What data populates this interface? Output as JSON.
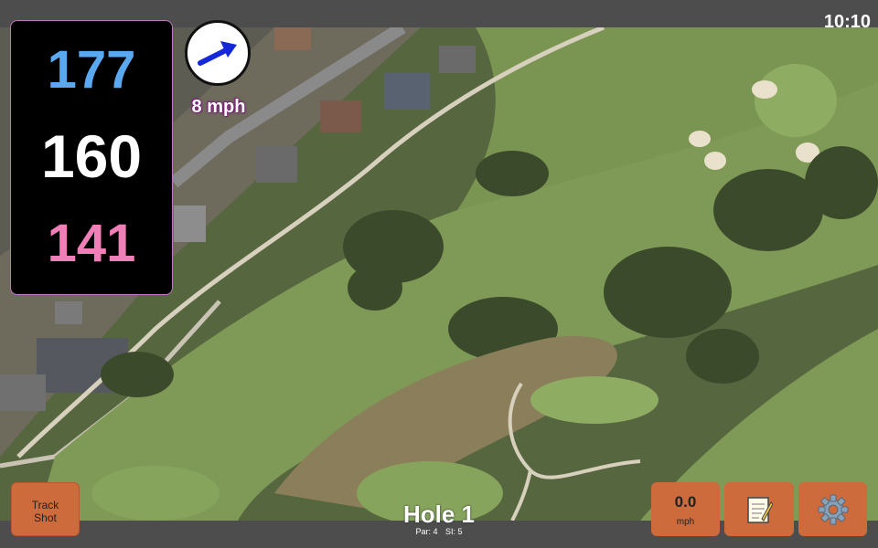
{
  "status": {
    "time": "10:10"
  },
  "yardage": {
    "back": "177",
    "middle": "160",
    "front": "141"
  },
  "wind": {
    "speed": "8 mph",
    "arrow_icon": "wind-direction-arrow-icon"
  },
  "hole": {
    "title": "Hole 1",
    "par": "Par: 4",
    "stroke_index": "SI: 5"
  },
  "buttons": {
    "track_line1": "Track",
    "track_line2": "Shot",
    "speed_value": "0.0",
    "speed_unit": "mph",
    "notes_icon": "notepad-icon",
    "settings_icon": "gear-icon"
  },
  "colors": {
    "back": "#5aa8f0",
    "middle": "#ffffff",
    "front": "#f07fb8",
    "button": "#cd6b3c",
    "wind_text_outline": "#7a1f7a"
  }
}
